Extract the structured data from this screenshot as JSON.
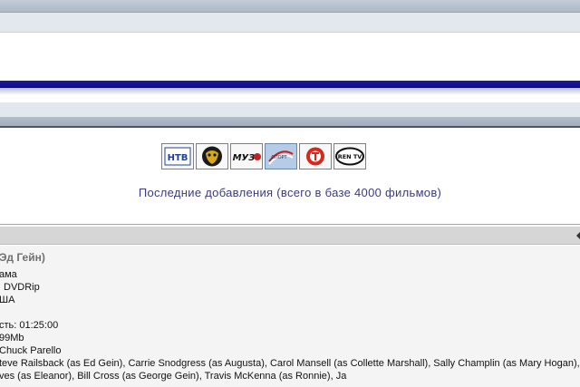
{
  "channels": [
    {
      "name": "ntv",
      "icon": "ntv-logo-icon",
      "label": "НТВ"
    },
    {
      "name": "tv3",
      "icon": "mask-logo-icon",
      "label": ""
    },
    {
      "name": "muz",
      "icon": "muz-tv-logo-icon",
      "label": "МУЗ"
    },
    {
      "name": "sport",
      "icon": "sport-logo-icon",
      "label": "СПОРТ",
      "selected": true
    },
    {
      "name": "tnt",
      "icon": "tnt-logo-icon",
      "label": ""
    },
    {
      "name": "ren",
      "icon": "ren-tv-logo-icon",
      "label": "REN TV"
    }
  ],
  "recent": {
    "title": "Последние добавления (всего в базе 4000 фильмов)"
  },
  "movie": {
    "title": "Эд Гейн)",
    "genre": "ама",
    "quality": "DVDRip",
    "country": "ША",
    "duration": "сть: 01:25:00",
    "size": "99Mb",
    "director": "Chuck Parello",
    "cast_line1": "teve Railsback (as Ed Gein), Carrie Snodgress (as Augusta), Carol Mansell (as Collette Marshall), Sally Champlin (as Mary Hogan), St",
    "cast_line2": "ves (as Eleanor), Bill Cross (as George Gein), Travis McKenna (as Ronnie), Ja"
  },
  "colors": {
    "accent_blue": "#1a1aa6",
    "title_text": "#3b3b7d",
    "grey_bar": "#d6d6d6"
  }
}
